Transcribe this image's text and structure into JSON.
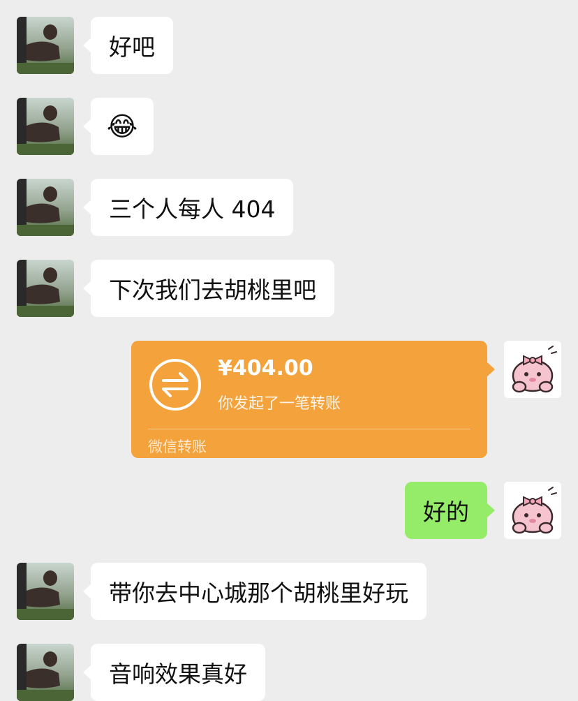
{
  "messages": [
    {
      "side": "in",
      "text": "好吧"
    },
    {
      "side": "in",
      "emoji": "😂"
    },
    {
      "side": "in",
      "text": "三个人每人 404"
    },
    {
      "side": "in",
      "text": "下次我们去胡桃里吧"
    },
    {
      "side": "out",
      "type": "transfer",
      "amount": "¥404.00",
      "desc": "你发起了一笔转账",
      "footer": "微信转账"
    },
    {
      "side": "out",
      "text": "好的"
    },
    {
      "side": "in",
      "text": "带你去中心城那个胡桃里好玩"
    },
    {
      "side": "in",
      "text": "音响效果真好"
    }
  ],
  "colors": {
    "background": "#ededed",
    "incoming_bubble": "#ffffff",
    "outgoing_bubble": "#95ec69",
    "transfer_card": "#f4a23b"
  },
  "icons": {
    "transfer": "transfer-arrows-icon",
    "emoji": "face-with-tears-of-joy-icon"
  }
}
